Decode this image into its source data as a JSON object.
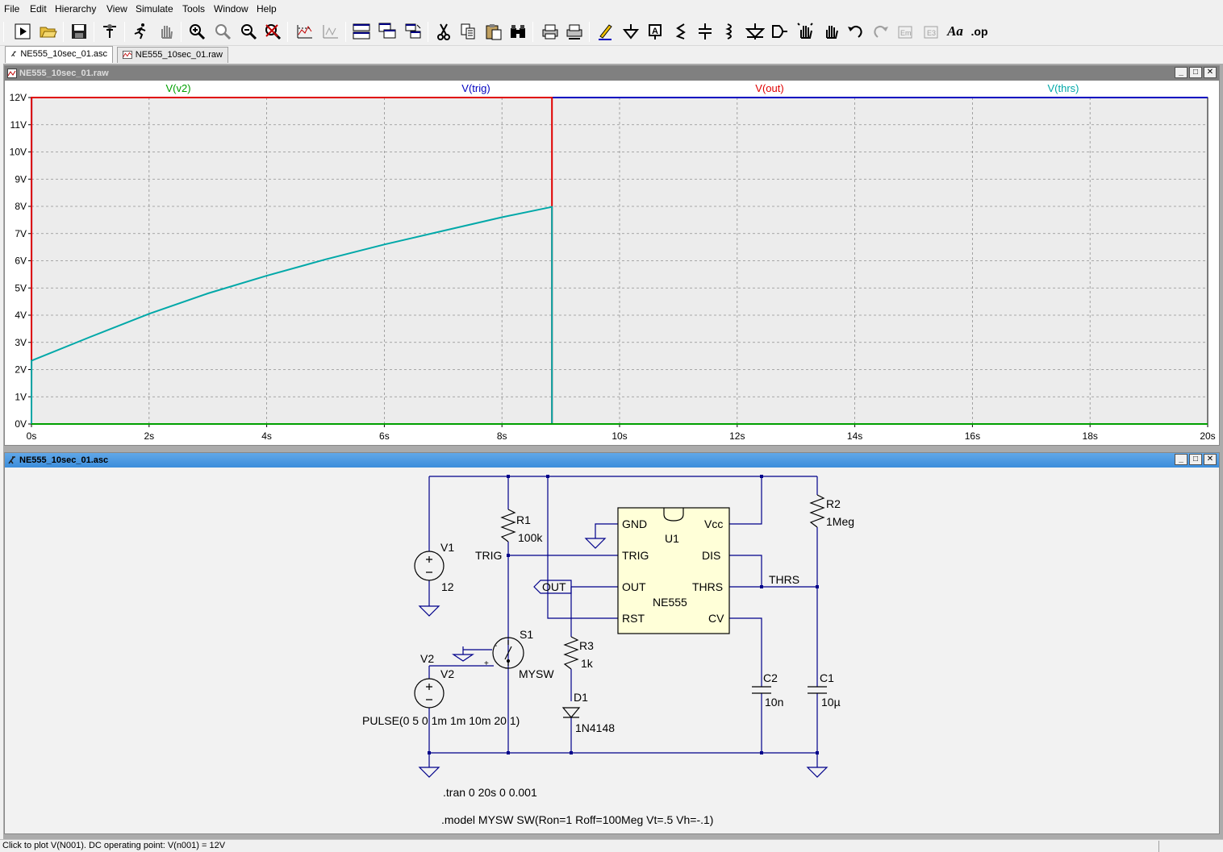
{
  "menu": {
    "items": [
      {
        "label": "File"
      },
      {
        "label": "Edit"
      },
      {
        "label": "Hierarchy"
      },
      {
        "label": "View"
      },
      {
        "label": "Simulate"
      },
      {
        "label": "Tools"
      },
      {
        "label": "Window"
      },
      {
        "label": "Help"
      }
    ]
  },
  "toolbar": {
    "op_label": ".op",
    "text_label": "Aa"
  },
  "tabs": [
    {
      "label": "NE555_10sec_01.asc",
      "icon": "schematic-icon"
    },
    {
      "label": "NE555_10sec_01.raw",
      "icon": "waveform-icon"
    }
  ],
  "plot_window": {
    "title": "NE555_10sec_01.raw"
  },
  "schematic_window": {
    "title": "NE555_10sec_01.asc"
  },
  "chart_data": {
    "type": "line",
    "series": [
      {
        "name": "V(v2)",
        "color": "#00a000",
        "x": [
          0,
          20
        ],
        "y": [
          0,
          0
        ]
      },
      {
        "name": "V(trig)",
        "color": "#0000c0",
        "x": [
          0,
          0.001,
          20
        ],
        "y": [
          0,
          12,
          12
        ]
      },
      {
        "name": "V(out)",
        "color": "#e00000",
        "x": [
          0,
          0.001,
          8.85,
          8.85,
          8.851,
          20
        ],
        "y": [
          0,
          12,
          12,
          8,
          0,
          0
        ]
      },
      {
        "name": "V(thrs)",
        "color": "#00a8a8",
        "x": [
          0,
          0.001,
          1,
          2,
          3,
          4,
          5,
          6,
          7,
          8,
          8.85,
          8.851,
          20
        ],
        "y": [
          0,
          2.33,
          3.2,
          4.05,
          4.8,
          5.45,
          6.05,
          6.6,
          7.1,
          7.6,
          7.98,
          0,
          0
        ]
      }
    ],
    "xlim": [
      0,
      20
    ],
    "ylim": [
      0,
      12
    ],
    "x_ticks": [
      "0s",
      "2s",
      "4s",
      "6s",
      "8s",
      "10s",
      "12s",
      "14s",
      "16s",
      "18s",
      "20s"
    ],
    "y_ticks": [
      "0V",
      "1V",
      "2V",
      "3V",
      "4V",
      "5V",
      "6V",
      "7V",
      "8V",
      "9V",
      "10V",
      "11V",
      "12V"
    ],
    "grid": true
  },
  "schematic": {
    "r1_name": "R1",
    "r1_value": "100k",
    "r2_name": "R2",
    "r2_value": "1Meg",
    "r3_name": "R3",
    "r3_value": "1k",
    "c1_name": "C1",
    "c1_value": "10µ",
    "c2_name": "C2",
    "c2_value": "10n",
    "v1_name": "V1",
    "v1_value": "12",
    "v2_name": "V2",
    "v2_value": "PULSE(0 5 0 1m 1m 10m 20 1)",
    "v2_net": "V2",
    "s1_name": "S1",
    "s1_model": "MYSW",
    "d1_name": "D1",
    "d1_model": "1N4148",
    "u1_name": "U1",
    "u1_model": "NE555",
    "pins": {
      "gnd": "GND",
      "vcc": "Vcc",
      "trig": "TRIG",
      "dis": "DIS",
      "out": "OUT",
      "thrs": "THRS",
      "rst": "RST",
      "cv": "CV"
    },
    "net_trig": "TRIG",
    "net_thrs": "THRS",
    "net_out": "OUT",
    "directive_tran": ".tran 0 20s 0 0.001",
    "directive_model": ".model MYSW SW(Ron=1 Roff=100Meg Vt=.5 Vh=-.1)"
  },
  "status": {
    "text": "Click to plot V(N001).  DC operating point: V(n001) = 12V"
  }
}
